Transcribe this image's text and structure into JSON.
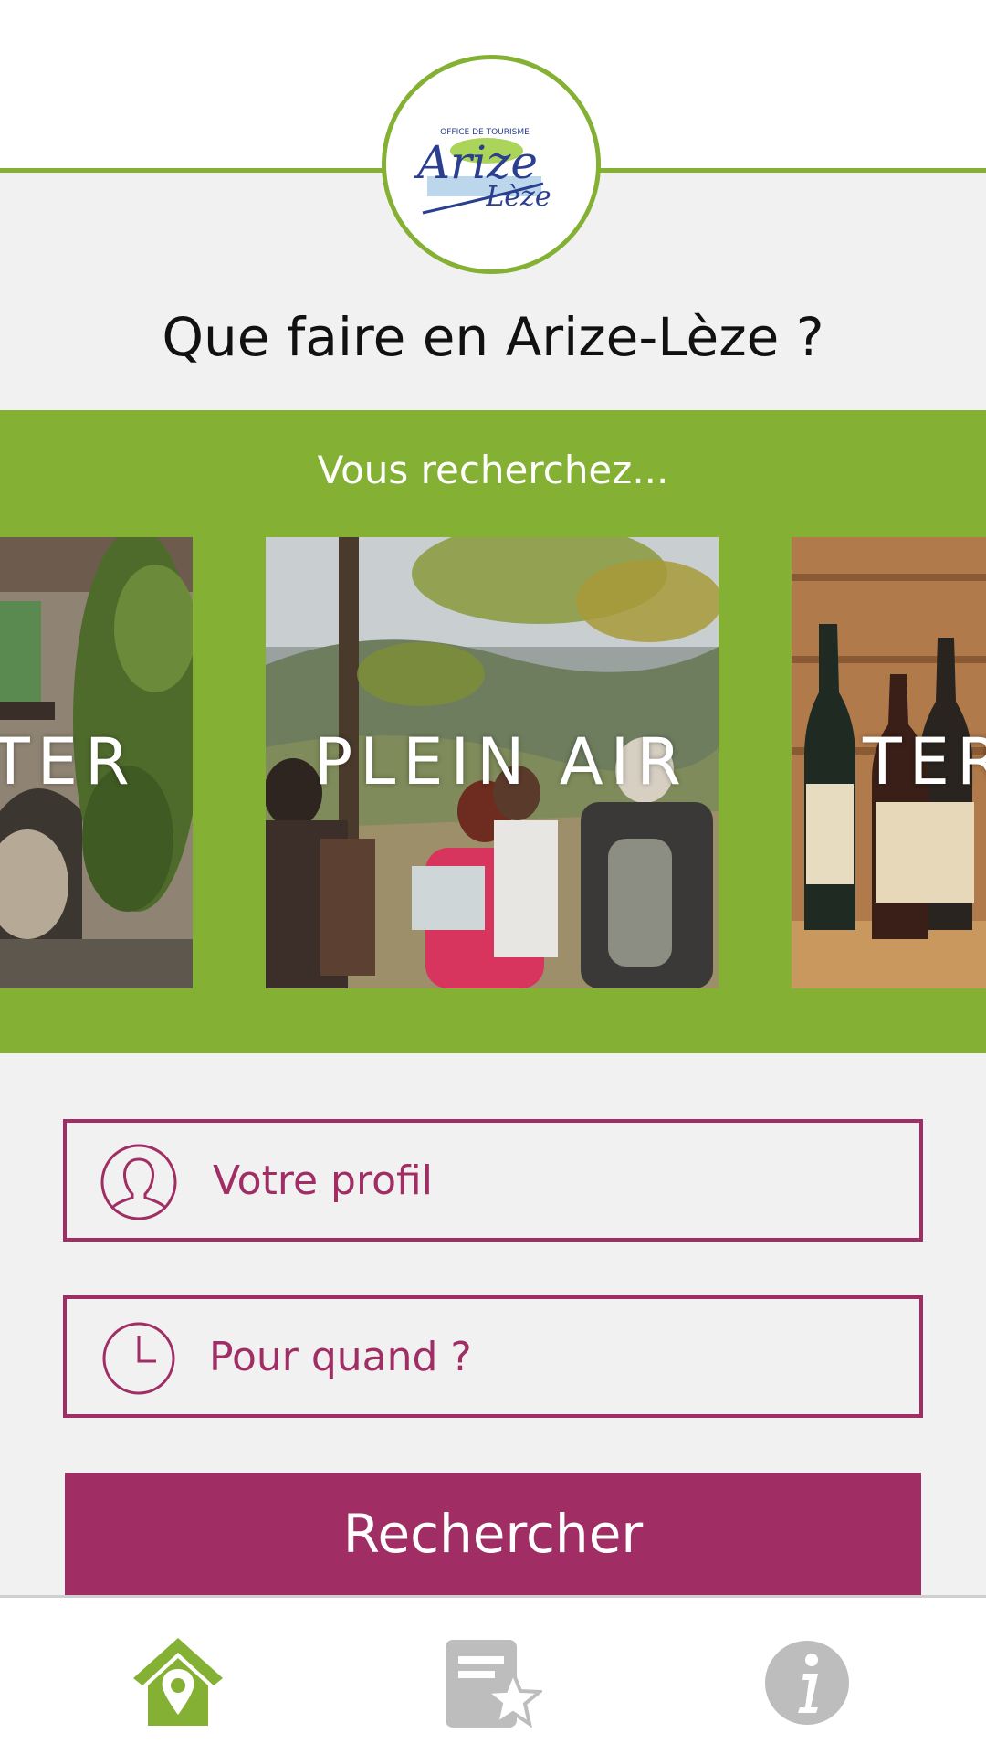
{
  "header": {
    "logo": {
      "small_text": "OFFICE DE TOURISME",
      "name_top": "Arize",
      "name_bottom": "Lèze"
    },
    "title": "Que faire en Arize-Lèze ?"
  },
  "carousel": {
    "label": "Vous recherchez...",
    "cards": [
      {
        "label": "TER"
      },
      {
        "label": "PLEIN AIR"
      },
      {
        "label": "TER"
      }
    ]
  },
  "form": {
    "profile_label": "Votre profil",
    "when_label": "Pour quand ?",
    "search_label": "Rechercher"
  },
  "nav": {
    "items": [
      {
        "icon": "home-location-icon",
        "active": true
      },
      {
        "icon": "favorites-icon",
        "active": false
      },
      {
        "icon": "info-icon",
        "active": false
      }
    ]
  },
  "colors": {
    "accent_green": "#84b034",
    "accent_purple": "#a02e64",
    "background": "#f1f1f1",
    "inactive_icon": "#bdbdbd"
  }
}
